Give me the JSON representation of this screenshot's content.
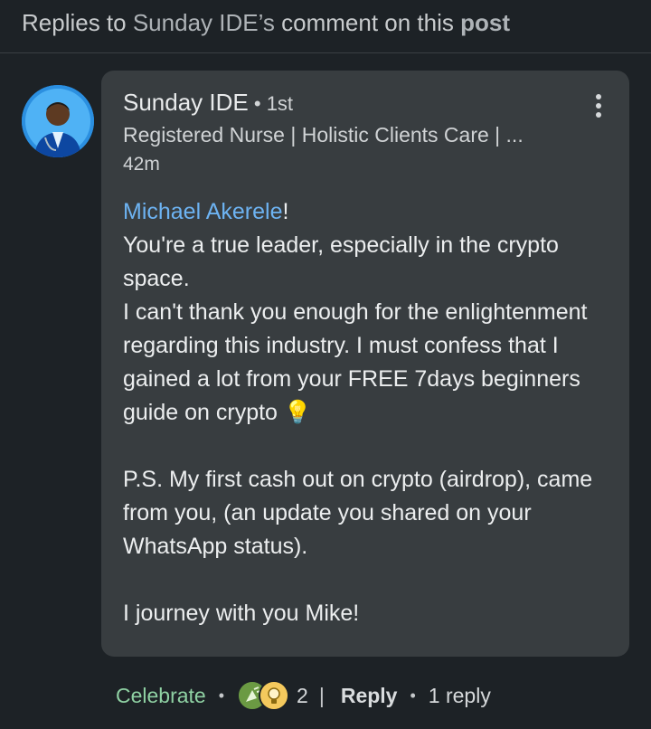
{
  "header": {
    "prefix": "Replies to ",
    "author": "Sunday IDE’s",
    "middle": " comment on this ",
    "object": "post"
  },
  "comment": {
    "author": "Sunday IDE",
    "separator": " • ",
    "degree": "1st",
    "headline": "Registered Nurse | Holistic Clients Care | ...",
    "time": "42m",
    "mention": "Michael Akerele",
    "mention_suffix": "!",
    "lines": [
      "You're a true leader, especially in the crypto space.",
      "I can't thank you enough for the enlightenment regarding this industry. I must confess that I gained a lot from your FREE 7days beginners guide on crypto 💡"
    ],
    "ps": "P.S. My first cash out on crypto (airdrop), came from you, (an update you shared on your WhatsApp status).",
    "closing": "I journey with you Mike!"
  },
  "actions": {
    "celebrate_label": "Celebrate",
    "dot": "•",
    "reaction_count": "2",
    "divider": "|",
    "reply_label": "Reply",
    "replies_label": "1 reply"
  },
  "colors": {
    "background": "#1d2226",
    "bubble": "#383d40",
    "mention": "#6db3f2",
    "celebrate": "#8fd1a3"
  },
  "icons": [
    "avatar",
    "more-vertical-icon",
    "celebrate-reaction-icon",
    "insightful-reaction-icon",
    "lightbulb-emoji"
  ]
}
